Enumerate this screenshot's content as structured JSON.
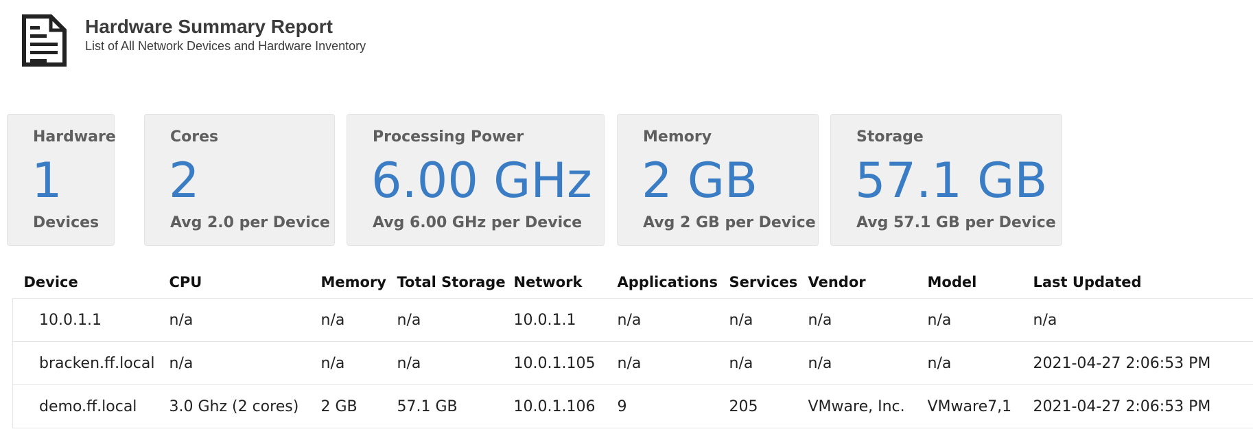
{
  "header": {
    "icon": "document-icon",
    "title": "Hardware Summary Report",
    "subtitle": "List of All Network Devices and Hardware Inventory"
  },
  "cards": [
    {
      "label": "Hardware",
      "value": "1",
      "sub": "Devices"
    },
    {
      "label": "Cores",
      "value": "2",
      "sub": "Avg 2.0 per Device"
    },
    {
      "label": "Processing Power",
      "value": "6.00 GHz",
      "sub": "Avg 6.00 GHz per Device"
    },
    {
      "label": "Memory",
      "value": "2 GB",
      "sub": "Avg 2 GB per Device"
    },
    {
      "label": "Storage",
      "value": "57.1 GB",
      "sub": "Avg 57.1 GB per Device"
    }
  ],
  "table": {
    "columns": [
      "Device",
      "CPU",
      "Memory",
      "Total Storage",
      "Network",
      "Applications",
      "Services",
      "Vendor",
      "Model",
      "Last Updated"
    ],
    "rows": [
      [
        "10.0.1.1",
        "n/a",
        "n/a",
        "n/a",
        "10.0.1.1",
        "n/a",
        "n/a",
        "n/a",
        "n/a",
        "n/a"
      ],
      [
        "bracken.ff.local",
        "n/a",
        "n/a",
        "n/a",
        "10.0.1.105",
        "n/a",
        "n/a",
        "n/a",
        "n/a",
        "2021-04-27 2:06:53 PM"
      ],
      [
        "demo.ff.local",
        "3.0 Ghz (2 cores)",
        "2 GB",
        "57.1 GB",
        "10.0.1.106",
        "9",
        "205",
        "VMware, Inc.",
        "VMware7,1",
        "2021-04-27 2:06:53 PM"
      ]
    ]
  },
  "colors": {
    "accent": "#3b7dc4",
    "card_bg": "#f0f0f0",
    "label": "#5f5f5f"
  }
}
